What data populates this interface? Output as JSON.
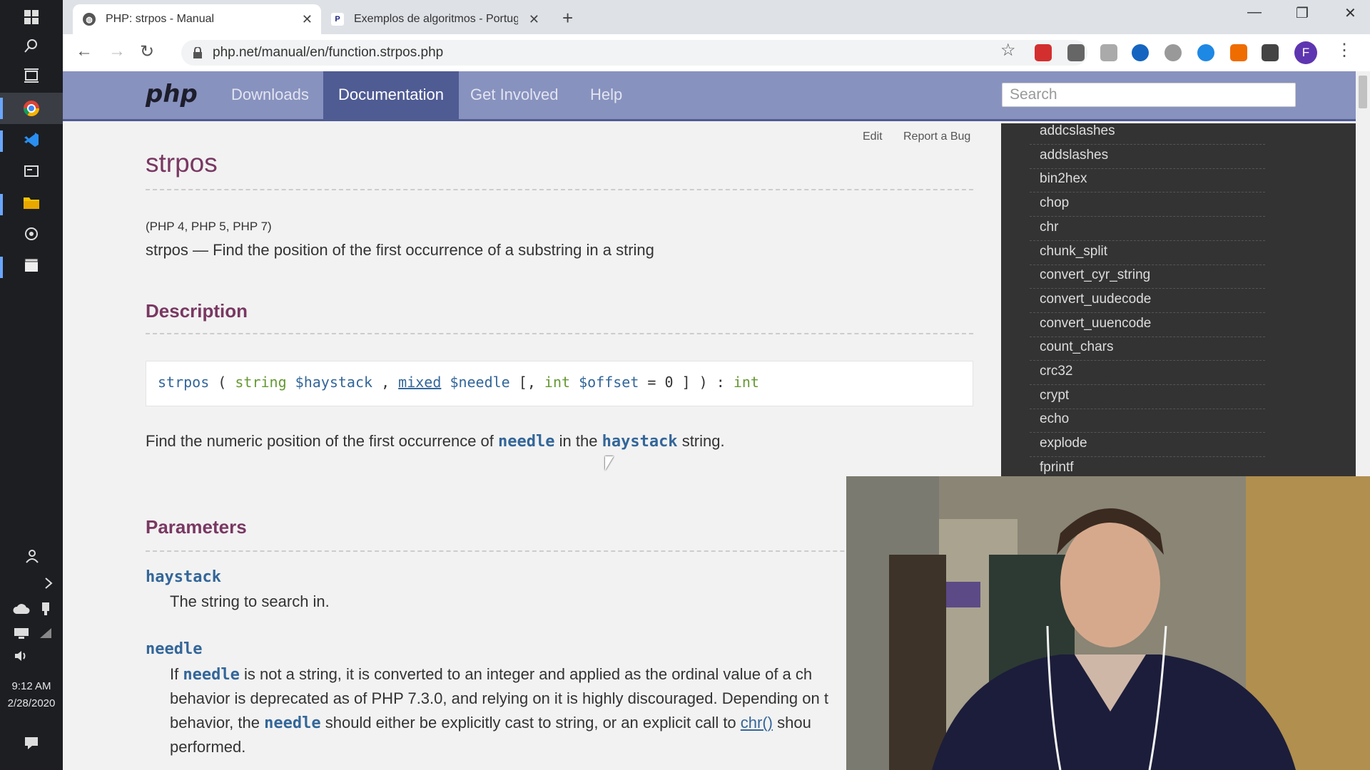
{
  "taskbar": {
    "clock_time": "9:12 AM",
    "clock_date": "2/28/2020"
  },
  "browser": {
    "tabs": [
      {
        "label": "PHP: strpos - Manual",
        "active": true
      },
      {
        "label": "Exemplos de algoritmos - Portug",
        "active": false
      }
    ],
    "url": "php.net/manual/en/function.strpos.php",
    "profile_initial": "F"
  },
  "php_nav": {
    "logo": "php",
    "links": [
      "Downloads",
      "Documentation",
      "Get Involved",
      "Help"
    ],
    "active_link": "Documentation",
    "search_placeholder": "Search"
  },
  "content": {
    "edit_label": "Edit",
    "report_bug_label": "Report a Bug",
    "title": "strpos",
    "versions": "(PHP 4, PHP 5, PHP 7)",
    "purpose": "strpos — Find the position of the first occurrence of a substring in a string",
    "description_heading": "Description",
    "signature": {
      "fn": "strpos",
      "p1_type": "string",
      "p1_var": "$haystack",
      "p2_type": "mixed",
      "p2_var": "$needle",
      "p3_type": "int",
      "p3_var": "$offset",
      "p3_default": "0",
      "return_type": "int"
    },
    "description_text_1": "Find the numeric position of the first occurrence of",
    "description_needle": "needle",
    "description_text_2": "in the",
    "description_haystack": "haystack",
    "description_text_3": "string.",
    "parameters_heading": "Parameters",
    "params": [
      {
        "name": "haystack",
        "desc": "The string to search in."
      },
      {
        "name": "needle"
      }
    ],
    "needle_line1_a": "If",
    "needle_line1_b": "needle",
    "needle_line1_c": "is not a string, it is converted to an integer and applied as the ordinal value of a ch",
    "needle_line2": "behavior is deprecated as of PHP 7.3.0, and relying on it is highly discouraged. Depending on t",
    "needle_line3_a": "behavior, the",
    "needle_line3_b": "needle",
    "needle_line3_c": "should either be explicitly cast to string, or an explicit call to",
    "needle_line3_link": "chr()",
    "needle_line3_d": "shou",
    "needle_line4": "performed."
  },
  "sidebar": {
    "items": [
      "addcslashes",
      "addslashes",
      "bin2hex",
      "chop",
      "chr",
      "chunk_split",
      "convert_cyr_string",
      "convert_uudecode",
      "convert_uuencode",
      "count_chars",
      "crc32",
      "crypt",
      "echo",
      "explode",
      "fprintf"
    ]
  },
  "colors": {
    "php_nav_bg": "#8892bf",
    "php_nav_active": "#4f5b93",
    "heading": "#793862",
    "code_var": "#336699",
    "code_type": "#669933",
    "sidebar_bg": "#333333"
  },
  "icons": {
    "taskbar": [
      "windows-start-icon",
      "search-icon",
      "task-view-icon",
      "chrome-icon",
      "vscode-icon",
      "terminal-icon",
      "file-explorer-icon",
      "settings-icon",
      "video-editor-icon",
      "people-icon",
      "chevron-icon",
      "cloud-icon",
      "usb-icon",
      "network-icon",
      "wifi-icon",
      "volume-icon",
      "notifications-icon"
    ],
    "toolbar": [
      "back-icon",
      "forward-icon",
      "reload-icon",
      "lock-icon",
      "star-icon",
      "menu-icon"
    ]
  }
}
